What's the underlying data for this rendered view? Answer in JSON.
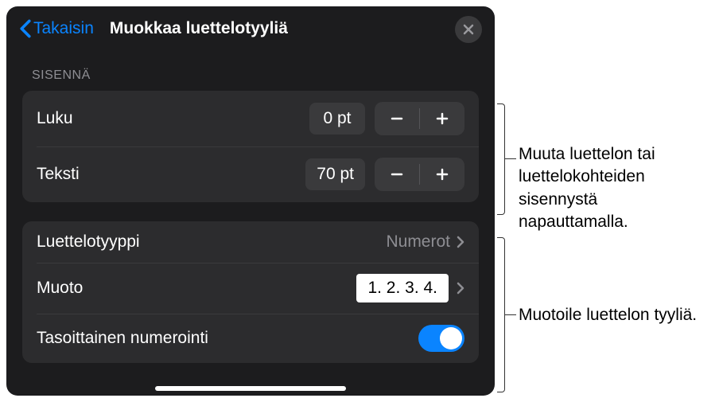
{
  "header": {
    "back_label": "Takaisin",
    "title": "Muokkaa luettelotyyliä"
  },
  "indent": {
    "section_title": "SISENNÄ",
    "number_label": "Luku",
    "number_value": "0 pt",
    "text_label": "Teksti",
    "text_value": "70 pt"
  },
  "list": {
    "type_label": "Luettelotyyppi",
    "type_value": "Numerot",
    "format_label": "Muoto",
    "format_preview": "1. 2. 3. 4.",
    "tiered_label": "Tasoittainen numerointi"
  },
  "callouts": {
    "indent_text": "Muuta luettelon tai luettelokohteiden sisennystä napauttamalla.",
    "format_text": "Muotoile luettelon tyyliä."
  }
}
